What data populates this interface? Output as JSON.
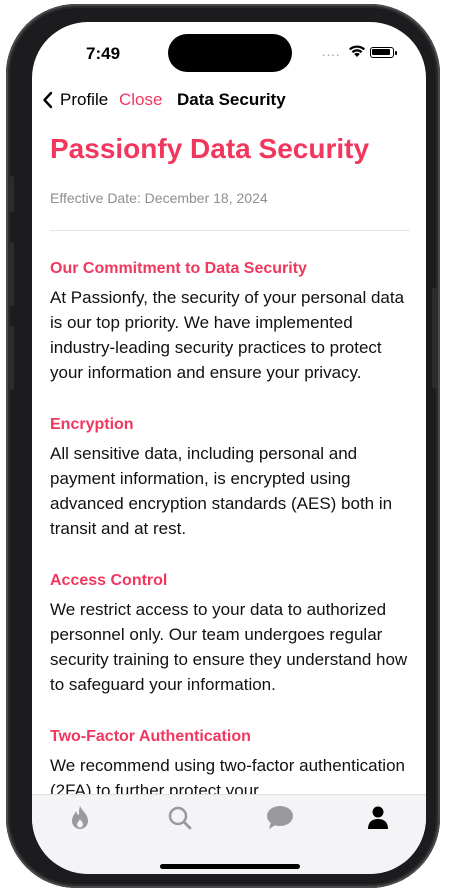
{
  "status": {
    "time": "7:49",
    "signal": "...."
  },
  "nav": {
    "back_label": "Profile",
    "close_label": "Close",
    "title": "Data Security"
  },
  "page": {
    "title": "Passionfy Data Security",
    "effective_date": "Effective Date: December 18, 2024"
  },
  "sections": [
    {
      "title": "Our Commitment to Data Security",
      "body": "At Passionfy, the security of your personal data is our top priority. We have implemented industry-leading security practices to protect your information and ensure your privacy."
    },
    {
      "title": "Encryption",
      "body": "All sensitive data, including personal and payment information, is encrypted using advanced encryption standards (AES) both in transit and at rest."
    },
    {
      "title": "Access Control",
      "body": "We restrict access to your data to authorized personnel only. Our team undergoes regular security training to ensure they understand how to safeguard your information."
    },
    {
      "title": "Two-Factor Authentication",
      "body": "We recommend using two-factor authentication (2FA) to further protect your"
    }
  ],
  "tabbar": {
    "tabs": [
      {
        "icon": "flame-icon",
        "active": false
      },
      {
        "icon": "search-icon",
        "active": false
      },
      {
        "icon": "chat-bubble-icon",
        "active": false
      },
      {
        "icon": "person-icon",
        "active": true
      }
    ]
  },
  "colors": {
    "accent": "#f2375f",
    "inactive_tab": "#9a9a9e",
    "active_tab": "#000000"
  }
}
